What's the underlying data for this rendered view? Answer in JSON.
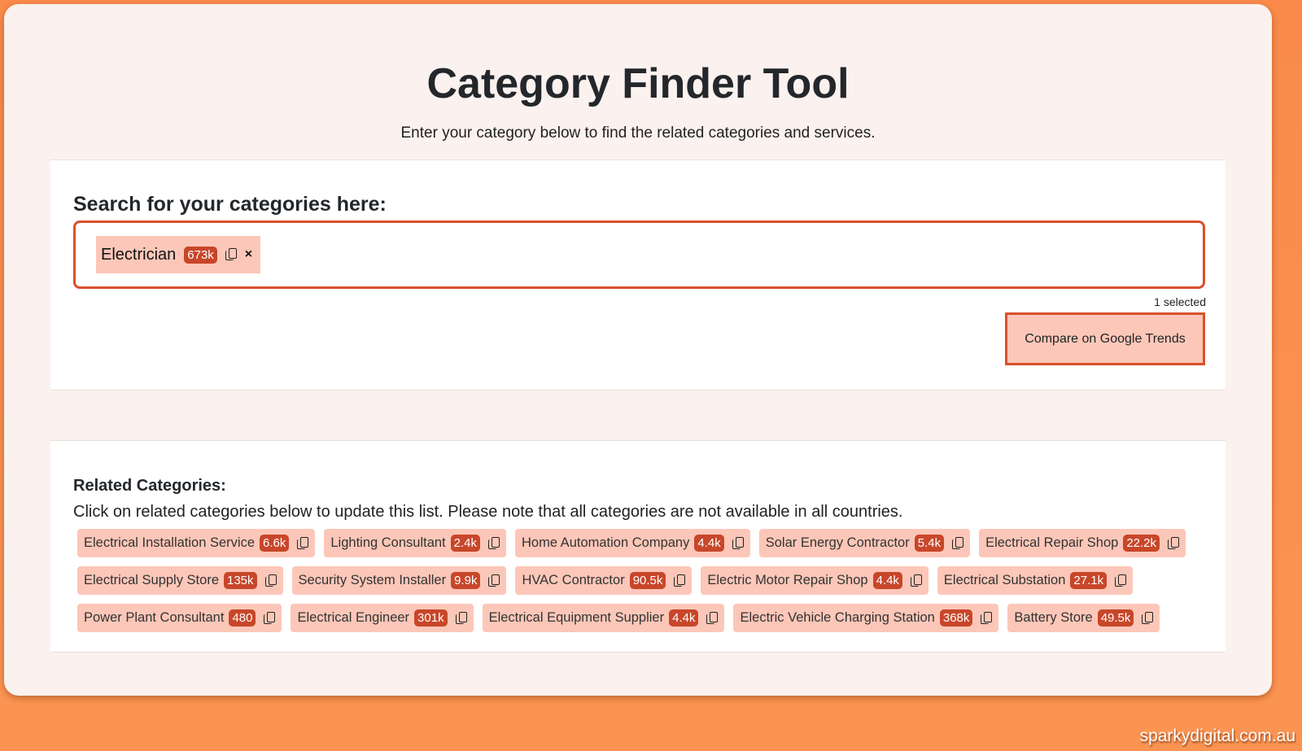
{
  "header": {
    "title": "Category Finder Tool",
    "subtitle": "Enter your category below to find the related categories and services."
  },
  "search": {
    "heading": "Search for your categories here:",
    "selected": [
      {
        "label": "Electrician",
        "count": "673k"
      }
    ],
    "remove_symbol": "×",
    "selected_count": "1 selected",
    "compare_label": "Compare on Google Trends"
  },
  "related": {
    "heading": "Related Categories:",
    "description": "Click on related categories below to update this list. Please note that all categories are not available in all countries.",
    "items": [
      {
        "label": "Electrical Installation Service",
        "count": "6.6k"
      },
      {
        "label": "Lighting Consultant",
        "count": "2.4k"
      },
      {
        "label": "Home Automation Company",
        "count": "4.4k"
      },
      {
        "label": "Solar Energy Contractor",
        "count": "5.4k"
      },
      {
        "label": "Electrical Repair Shop",
        "count": "22.2k"
      },
      {
        "label": "Electrical Supply Store",
        "count": "135k"
      },
      {
        "label": "Security System Installer",
        "count": "9.9k"
      },
      {
        "label": "HVAC Contractor",
        "count": "90.5k"
      },
      {
        "label": "Electric Motor Repair Shop",
        "count": "4.4k"
      },
      {
        "label": "Electrical Substation",
        "count": "27.1k"
      },
      {
        "label": "Power Plant Consultant",
        "count": "480"
      },
      {
        "label": "Electrical Engineer",
        "count": "301k"
      },
      {
        "label": "Electrical Equipment Supplier",
        "count": "4.4k"
      },
      {
        "label": "Electric Vehicle Charging Station",
        "count": "368k"
      },
      {
        "label": "Battery Store",
        "count": "49.5k"
      }
    ]
  },
  "footer": {
    "brand": "sparkydigital.com.au"
  },
  "colors": {
    "accent": "#d9512c",
    "chip": "#fcc7b8",
    "badge": "#c8462a",
    "background": "#fb9452"
  }
}
